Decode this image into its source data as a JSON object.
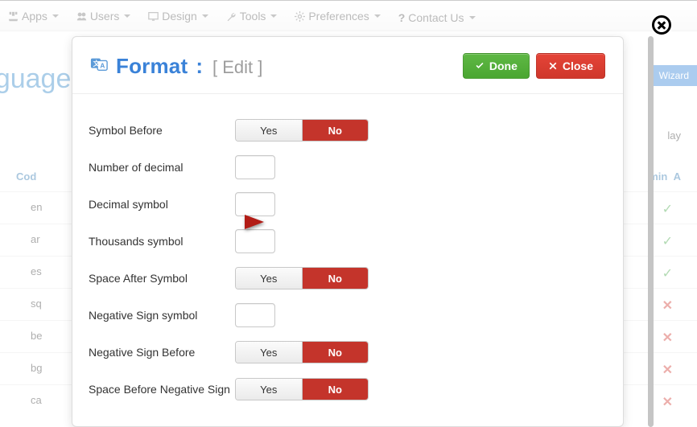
{
  "nav": {
    "apps": "Apps",
    "users": "Users",
    "design": "Design",
    "tools": "Tools",
    "prefs": "Preferences",
    "contact": "Contact Us"
  },
  "bg": {
    "title": "anguage",
    "wizard": "Wizard",
    "far_right_label": "lay",
    "th_code": "Cod",
    "th_admin": "min",
    "rows": [
      {
        "code": "en",
        "ok": true
      },
      {
        "code": "ar",
        "ok": true
      },
      {
        "code": "es",
        "ok": true
      },
      {
        "code": "sq",
        "ok": false
      },
      {
        "code": "be",
        "ok": false
      },
      {
        "code": "bg",
        "ok": false
      },
      {
        "code": "ca",
        "ok": false
      }
    ]
  },
  "dialog": {
    "title": "Format",
    "sub": "[ Edit ]",
    "done": "Done",
    "close": "Close",
    "fields": {
      "symbol_before": "Symbol Before",
      "num_decimal": "Number of decimal",
      "decimal_symbol": "Decimal symbol",
      "thousands_symbol": "Thousands symbol",
      "space_after_symbol": "Space After Symbol",
      "neg_sign_symbol": "Negative Sign symbol",
      "neg_sign_before": "Negative Sign Before",
      "space_before_neg": "Space Before Negative Sign"
    },
    "yes": "Yes",
    "no": "No",
    "values": {
      "num_decimal": "",
      "decimal_symbol": "",
      "thousands_symbol": "",
      "neg_sign_symbol": ""
    }
  }
}
